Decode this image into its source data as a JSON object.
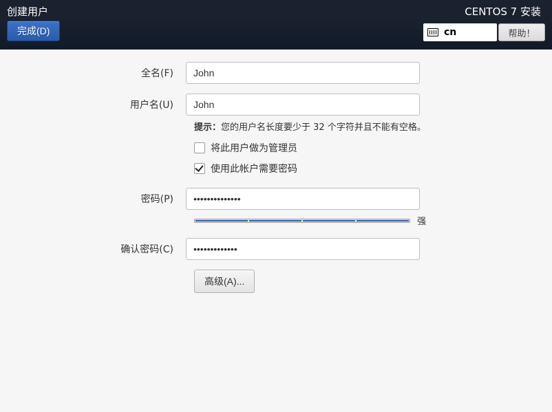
{
  "header": {
    "title_left": "创建用户",
    "title_right": "CENTOS 7 安装",
    "done_button": "完成(D)",
    "lang_code": "cn",
    "help_button": "帮助！"
  },
  "form": {
    "fullname_label": "全名(F)",
    "fullname_value": "John",
    "username_label": "用户名(U)",
    "username_value": "John",
    "tip_prefix": "提示：",
    "tip_text": "您的用户名长度要少于 32 个字符并且不能有空格。",
    "admin_checkbox_label": "将此用户做为管理员",
    "admin_checked": false,
    "require_pw_label": "使用此帐户需要密码",
    "require_pw_checked": true,
    "password_label": "密码(P)",
    "password_value": "••••••••••••••",
    "strength_label": "强",
    "confirm_label": "确认密码(C)",
    "confirm_value": "•••••••••••••",
    "advanced_button": "高级(A)..."
  }
}
